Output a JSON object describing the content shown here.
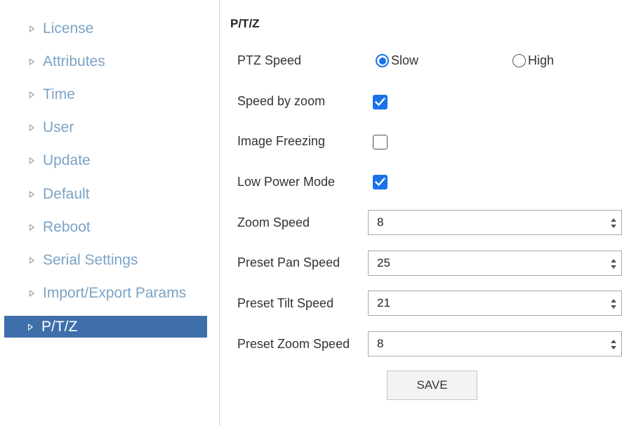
{
  "sidebar": {
    "items": [
      {
        "label": "License",
        "active": false
      },
      {
        "label": "Attributes",
        "active": false
      },
      {
        "label": "Time",
        "active": false
      },
      {
        "label": "User",
        "active": false
      },
      {
        "label": "Update",
        "active": false
      },
      {
        "label": "Default",
        "active": false
      },
      {
        "label": "Reboot",
        "active": false
      },
      {
        "label": "Serial Settings",
        "active": false
      },
      {
        "label": "Import/Export Params",
        "active": false
      },
      {
        "label": "P/T/Z",
        "active": true
      }
    ]
  },
  "main": {
    "title": "P/T/Z",
    "ptz_speed": {
      "label": "PTZ Speed",
      "options": [
        "Slow",
        "High"
      ],
      "selected": "Slow"
    },
    "speed_by_zoom": {
      "label": "Speed by zoom",
      "checked": true
    },
    "image_freezing": {
      "label": "Image Freezing",
      "checked": false
    },
    "low_power_mode": {
      "label": "Low Power Mode",
      "checked": true
    },
    "zoom_speed": {
      "label": "Zoom Speed",
      "value": "8"
    },
    "preset_pan_speed": {
      "label": "Preset Pan Speed",
      "value": "25"
    },
    "preset_tilt_speed": {
      "label": "Preset Tilt Speed",
      "value": "21"
    },
    "preset_zoom_speed": {
      "label": "Preset Zoom Speed",
      "value": "8"
    },
    "save_label": "SAVE"
  },
  "colors": {
    "accent": "#1a73e8",
    "nav_active_bg": "#3f6faa",
    "nav_text": "#7ba3c6"
  }
}
